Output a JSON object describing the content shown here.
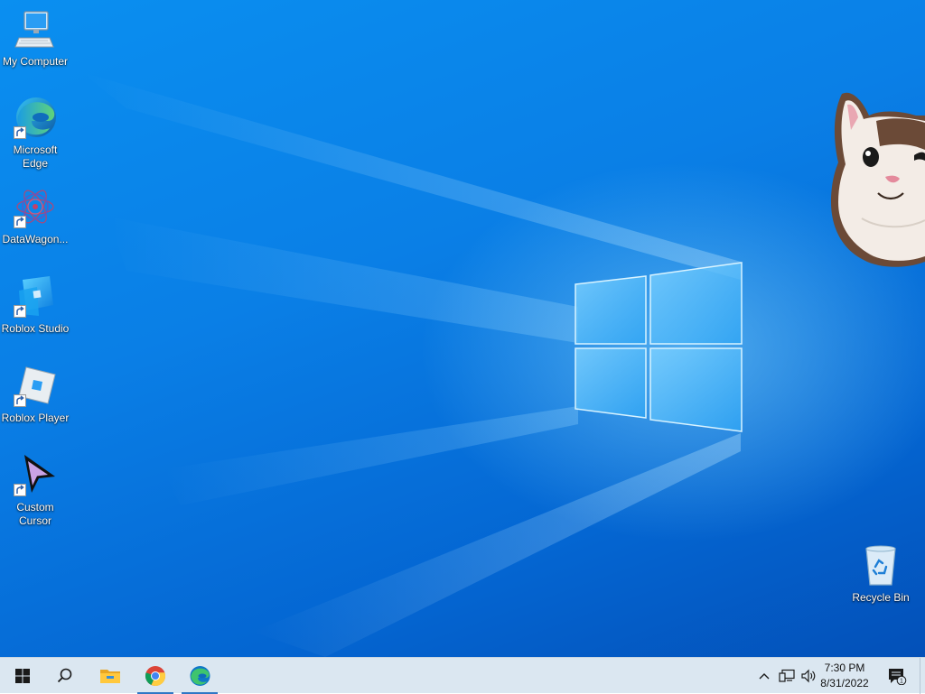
{
  "desktop": {
    "icons": [
      {
        "label": "My Computer",
        "icon": "computer-icon",
        "shortcut": false
      },
      {
        "label": "Microsoft Edge",
        "icon": "edge-icon",
        "shortcut": true
      },
      {
        "label": "DataWagon...",
        "icon": "datawagon-icon",
        "shortcut": true
      },
      {
        "label": "Roblox Studio",
        "icon": "roblox-studio-icon",
        "shortcut": true
      },
      {
        "label": "Roblox Player",
        "icon": "roblox-player-icon",
        "shortcut": true
      },
      {
        "label": "Custom Cursor",
        "icon": "cursor-icon",
        "shortcut": true
      }
    ],
    "recycle_bin": {
      "label": "Recycle Bin",
      "icon": "recycle-bin-icon"
    },
    "wallpaper": {
      "accent": "#0a7fe6",
      "logo": "windows-logo"
    }
  },
  "taskbar": {
    "background": "#dbe7f1",
    "accent": "#2f77c5",
    "buttons": [
      {
        "name": "start",
        "icon": "windows-start-icon"
      },
      {
        "name": "search",
        "icon": "search-icon"
      },
      {
        "name": "file-explorer",
        "icon": "folder-icon"
      },
      {
        "name": "chrome",
        "icon": "chrome-icon",
        "active": true
      },
      {
        "name": "edge",
        "icon": "edge-icon",
        "active": true
      }
    ],
    "tray": {
      "icons": [
        "chevron-up-icon",
        "network-icon",
        "volume-icon"
      ],
      "time": "7:30 PM",
      "date": "8/31/2022",
      "notifications": "1"
    }
  }
}
